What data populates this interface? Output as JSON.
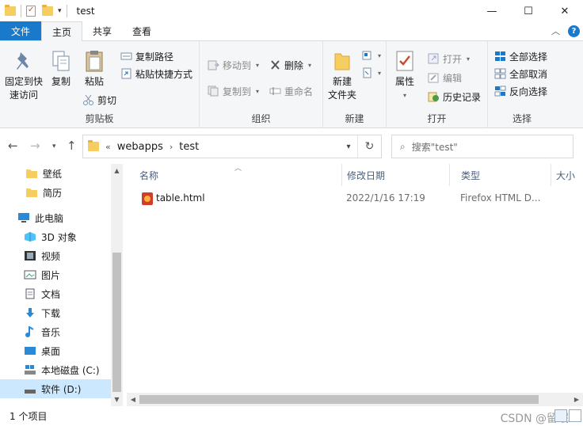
{
  "window": {
    "title": "test",
    "minimize": "—",
    "maximize": "☐",
    "close": "✕"
  },
  "tabs": {
    "file": "文件",
    "home": "主页",
    "share": "共享",
    "view": "查看"
  },
  "ribbon": {
    "clipboard": {
      "label": "剪贴板",
      "pin": [
        "固定到快",
        "速访问"
      ],
      "copy": "复制",
      "paste": "粘贴",
      "copy_path": "复制路径",
      "paste_shortcut": "粘贴快捷方式",
      "cut": "剪切"
    },
    "organize": {
      "label": "组织",
      "move_to": "移动到",
      "copy_to": "复制到",
      "delete": "删除",
      "rename": "重命名"
    },
    "new": {
      "label": "新建",
      "new_folder": [
        "新建",
        "文件夹"
      ]
    },
    "open": {
      "label": "打开",
      "properties": "属性",
      "open": "打开",
      "edit": "编辑",
      "history": "历史记录"
    },
    "select": {
      "label": "选择",
      "select_all": "全部选择",
      "select_none": "全部取消",
      "invert": "反向选择"
    }
  },
  "address": {
    "overflow": "«",
    "crumbs": [
      "webapps",
      "test"
    ],
    "search_placeholder": "搜索\"test\""
  },
  "nav": {
    "items": [
      {
        "label": "壁纸",
        "icon": "folder-icon"
      },
      {
        "label": "简历",
        "icon": "folder-icon"
      },
      {
        "label": "此电脑",
        "icon": "computer-icon"
      },
      {
        "label": "3D 对象",
        "icon": "3d-objects-icon"
      },
      {
        "label": "视频",
        "icon": "video-icon"
      },
      {
        "label": "图片",
        "icon": "pictures-icon"
      },
      {
        "label": "文档",
        "icon": "documents-icon"
      },
      {
        "label": "下载",
        "icon": "download-icon"
      },
      {
        "label": "音乐",
        "icon": "music-icon"
      },
      {
        "label": "桌面",
        "icon": "desktop-icon"
      },
      {
        "label": "本地磁盘 (C:)",
        "icon": "drive-icon"
      },
      {
        "label": "软件 (D:)",
        "icon": "drive-icon"
      }
    ],
    "selected_index": 11
  },
  "files": {
    "columns": {
      "name": "名称",
      "modified": "修改日期",
      "type": "类型",
      "size": "大小"
    },
    "rows": [
      {
        "name": "table.html",
        "modified": "2022/1/16 17:19",
        "type": "Firefox HTML D..."
      }
    ]
  },
  "status": {
    "count": "1 个项目",
    "watermark": "CSDN @留眠"
  }
}
